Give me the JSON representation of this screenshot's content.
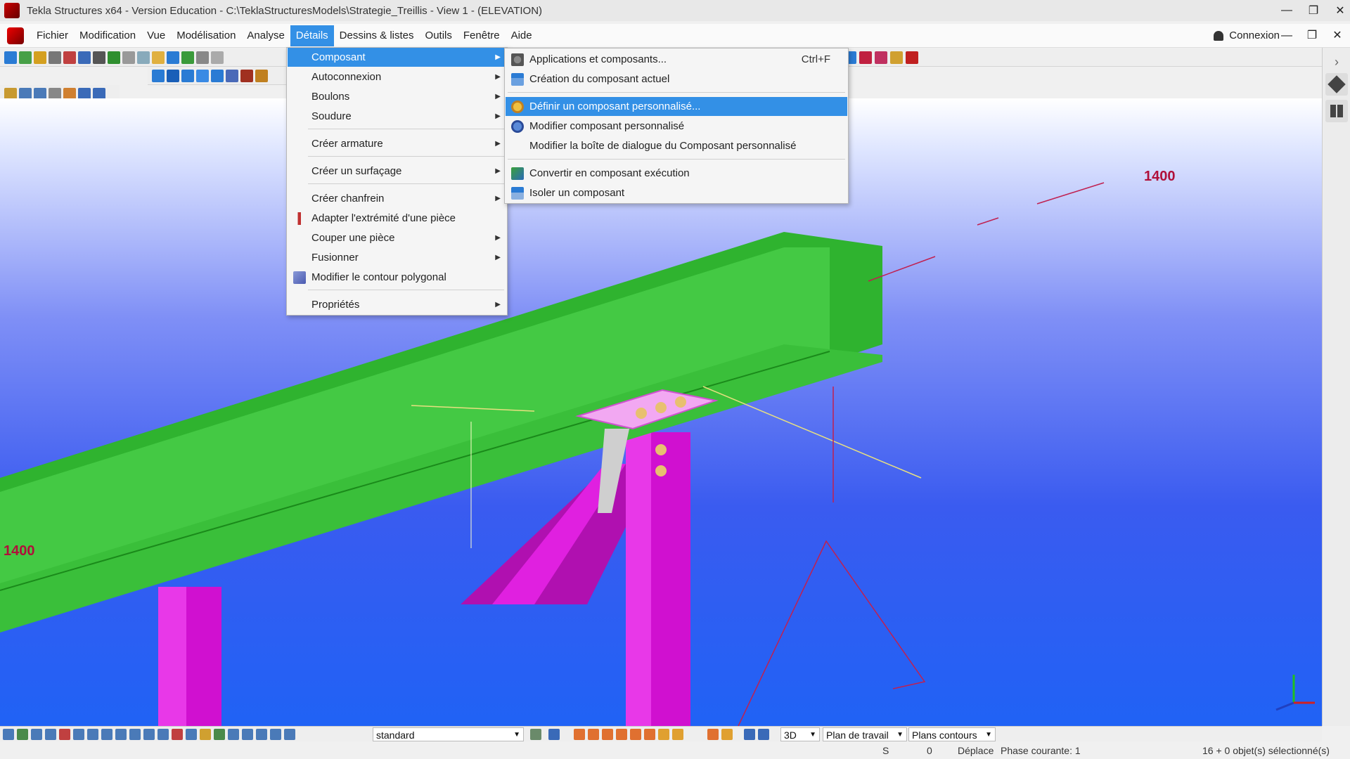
{
  "window": {
    "title": "Tekla Structures x64 - Version Education - C:\\TeklaStructuresModels\\Strategie_Treillis  - View 1 - (ELEVATION)",
    "minimize": "—",
    "maximize": "❐",
    "close": "✕"
  },
  "menubar": {
    "items": [
      "Fichier",
      "Modification",
      "Vue",
      "Modélisation",
      "Analyse",
      "Détails",
      "Dessins & listes",
      "Outils",
      "Fenêtre",
      "Aide"
    ],
    "active_index": 5,
    "connexion": "Connexion",
    "minimize": "—",
    "maximize": "❐",
    "close": "✕"
  },
  "details_menu": {
    "items": [
      {
        "label": "Composant",
        "submenu": true
      },
      {
        "label": "Autoconnexion",
        "submenu": true
      },
      {
        "label": "Boulons",
        "submenu": true
      },
      {
        "label": "Soudure",
        "submenu": true
      },
      {
        "label": "Créer armature",
        "submenu": true
      },
      {
        "label": "Créer un surfaçage",
        "submenu": true
      },
      {
        "label": "Créer chanfrein",
        "submenu": true
      },
      {
        "label": "Adapter l'extrémité d'une pièce",
        "submenu": false
      },
      {
        "label": "Couper une pièce",
        "submenu": true
      },
      {
        "label": "Fusionner",
        "submenu": true
      },
      {
        "label": "Modifier le contour polygonal",
        "submenu": false
      },
      {
        "label": "Propriétés",
        "submenu": true
      }
    ],
    "arrow": "▶"
  },
  "composant_submenu": {
    "items": [
      {
        "label": "Applications et composants...",
        "shortcut": "Ctrl+F"
      },
      {
        "label": "Création du composant actuel",
        "shortcut": ""
      },
      {
        "label": "Définir un composant personnalisé...",
        "shortcut": ""
      },
      {
        "label": "Modifier composant personnalisé",
        "shortcut": ""
      },
      {
        "label": "Modifier la boîte de dialogue du Composant personnalisé",
        "shortcut": ""
      },
      {
        "label": "Convertir en composant exécution",
        "shortcut": ""
      },
      {
        "label": "Isoler un composant",
        "shortcut": ""
      }
    ],
    "highlighted_index": 2
  },
  "viewport": {
    "dimension_label_left": "1400",
    "dimension_label_right": "1400",
    "colors": {
      "beam": "#3cc83c",
      "column": "#d010d0",
      "background": "#3a5bf0"
    }
  },
  "bottombar": {
    "filter_select": "standard",
    "view_mode": "3D",
    "snap_plane": "Plan de travail",
    "snap_option": "Plans contours",
    "caret": "▼"
  },
  "statusbar": {
    "mode": "S",
    "count": "0",
    "command": "Déplace",
    "phase": "Phase courante: 1",
    "selection": "16 + 0 objet(s) sélectionné(s)"
  },
  "icons": [
    "app-icon",
    "tekla-logo-icon",
    "user-icon",
    "side-panel-cube-icon",
    "side-panel-components-icon",
    "chevron-right-icon",
    "axis-gizmo-icon"
  ]
}
